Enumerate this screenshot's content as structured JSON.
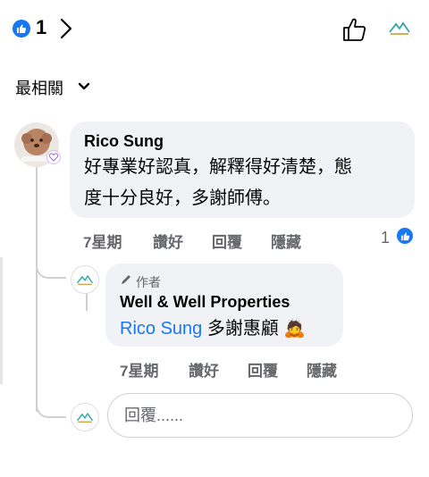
{
  "header": {
    "reaction_count": "1",
    "sort_label": "最相關"
  },
  "comment": {
    "author": "Rico Sung",
    "text_line1": "好專業好認真，解釋得好清楚，態",
    "text_line2": "度十分良好，多謝師傅。",
    "time": "7星期",
    "like_label": "讚好",
    "reply_label": "回覆",
    "hide_label": "隱藏",
    "like_count": "1"
  },
  "reply": {
    "badge": "作者",
    "author": "Well & Well Properties",
    "mention": "Rico Sung",
    "text": " 多謝惠顧",
    "emoji": "🙇",
    "time": "7星期",
    "like_label": "讚好",
    "reply_label": "回覆",
    "hide_label": "隱藏"
  },
  "composer": {
    "placeholder": "回覆......"
  },
  "colors": {
    "accent": "#1877f2",
    "bubble": "#f0f2f5",
    "secondary_text": "#65676b"
  }
}
